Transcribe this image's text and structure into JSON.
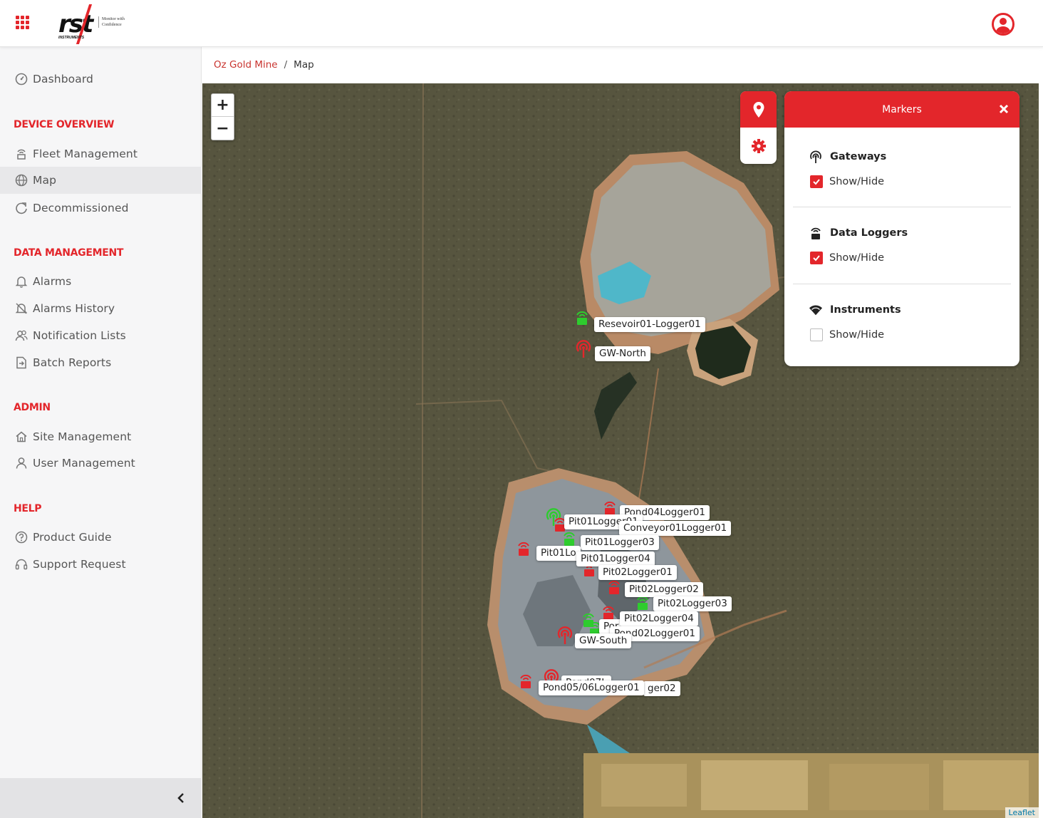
{
  "header": {
    "logo": {
      "wordmark": "rst",
      "subtext": "INSTRUMENTS",
      "tagline": "Monitor with Confidence"
    },
    "apps_icon": "apps-grid-icon",
    "user_icon": "user-circle-icon"
  },
  "sidebar": {
    "dashboard": "Dashboard",
    "sections": {
      "device_overview": "DEVICE OVERVIEW",
      "data_management": "DATA MANAGEMENT",
      "admin": "ADMIN",
      "help": "HELP"
    },
    "items": {
      "fleet_management": "Fleet Management",
      "map": "Map",
      "decommissioned": "Decommissioned",
      "alarms": "Alarms",
      "alarms_history": "Alarms History",
      "notification_lists": "Notification Lists",
      "batch_reports": "Batch Reports",
      "site_management": "Site Management",
      "user_management": "User Management",
      "product_guide": "Product Guide",
      "support_request": "Support Request"
    },
    "active": "Map"
  },
  "breadcrumb": {
    "site": "Oz Gold Mine",
    "separator": "/",
    "current": "Map"
  },
  "map": {
    "zoom_in": "+",
    "zoom_out": "−",
    "attribution": "Leaflet",
    "markers_panel": {
      "title": "Markers",
      "groups": [
        {
          "title": "Gateways",
          "toggle_label": "Show/Hide",
          "checked": true,
          "icon": "antenna-icon"
        },
        {
          "title": "Data Loggers",
          "toggle_label": "Show/Hide",
          "checked": true,
          "icon": "logger-icon"
        },
        {
          "title": "Instruments",
          "toggle_label": "Show/Hide",
          "checked": false,
          "icon": "wifi-icon"
        }
      ]
    },
    "labels": {
      "reservoir01_logger01": "Resevoir01-Logger01",
      "gw_north": "GW-North",
      "pond04_logger01": "Pond04Logger01",
      "pit01_logger01": "Pit01Logger01",
      "conveyor01_logger01": "Conveyor01Logger01",
      "pit01_logger03": "Pit01Logger03",
      "pit01_logger02": "Pit01Lo",
      "pit01_logger04": "Pit01Logger04",
      "pit02_logger01": "Pit02Logger01",
      "pit02_logger02": "Pit02Logger02",
      "pit02_logger03": "Pit02Logger03",
      "pit02_logger04": "Pit02Logger04",
      "pond03_partial": "Por",
      "pond02_logger01": "Pond02Logger01",
      "gw_south": "GW-South",
      "pond07_partial": "Pond07L",
      "pond_logger02_partial": "ger02",
      "pond0506_logger01": "Pond05/06Logger01"
    },
    "status_colors": {
      "ok": "#2ecc2e",
      "alarm": "#e3262b"
    }
  }
}
